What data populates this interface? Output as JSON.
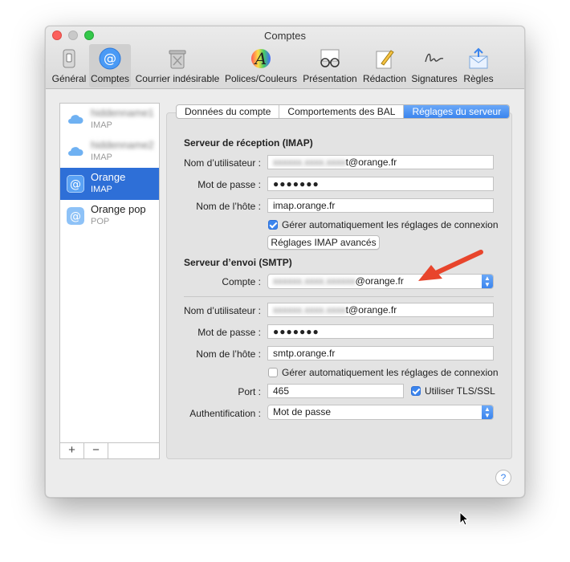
{
  "window": {
    "title": "Comptes"
  },
  "toolbar": {
    "items": [
      {
        "label": "Général",
        "icon": "switch-icon"
      },
      {
        "label": "Comptes",
        "icon": "at-icon",
        "selected": true
      },
      {
        "label": "Courrier indésirable",
        "icon": "trash-icon"
      },
      {
        "label": "Polices/Couleurs",
        "icon": "font-icon"
      },
      {
        "label": "Présentation",
        "icon": "glasses-icon"
      },
      {
        "label": "Rédaction",
        "icon": "pencil-icon"
      },
      {
        "label": "Signatures",
        "icon": "signature-icon"
      },
      {
        "label": "Règles",
        "icon": "rules-icon"
      }
    ]
  },
  "sidebar": {
    "accounts": [
      {
        "name": "hiddenname1",
        "type": "IMAP",
        "icon": "cloud-icon"
      },
      {
        "name": "hiddenname2",
        "type": "IMAP",
        "icon": "cloud-icon"
      },
      {
        "name": "Orange",
        "type": "IMAP",
        "icon": "at-icon",
        "selected": true
      },
      {
        "name": "Orange pop",
        "type": "POP",
        "icon": "at-icon"
      }
    ],
    "add_label": "+",
    "remove_label": "−"
  },
  "tabs": [
    {
      "label": "Données du compte"
    },
    {
      "label": "Comportements des BAL"
    },
    {
      "label": "Réglages du serveur",
      "active": true
    }
  ],
  "incoming": {
    "title": "Serveur de réception (IMAP)",
    "username_label": "Nom d’utilisateur :",
    "username_hidden": "xxxxxx.xxxx.xxxx",
    "username_suffix": "t@orange.fr",
    "password_label": "Mot de passe :",
    "password_value": "●●●●●●●",
    "host_label": "Nom de l’hôte :",
    "host_value": "imap.orange.fr",
    "auto_label": "Gérer automatiquement les réglages de connexion",
    "auto_checked": true,
    "advanced_button": "Réglages IMAP avancés"
  },
  "outgoing": {
    "title": "Serveur d’envoi (SMTP)",
    "account_label": "Compte :",
    "account_hidden": "xxxxxx.xxxx.xxxxxx",
    "account_suffix": "@orange.fr",
    "username_label": "Nom d’utilisateur :",
    "username_hidden": "xxxxxx.xxxx.xxxx",
    "username_suffix": "t@orange.fr",
    "password_label": "Mot de passe :",
    "password_value": "●●●●●●●",
    "host_label": "Nom de l’hôte :",
    "host_value": "smtp.orange.fr",
    "auto_label": "Gérer automatiquement les réglages de connexion",
    "auto_checked": false,
    "port_label": "Port :",
    "port_value": "465",
    "tls_label": "Utiliser TLS/SSL",
    "tls_checked": true,
    "auth_label": "Authentification :",
    "auth_value": "Mot de passe"
  },
  "help_label": "?",
  "colors": {
    "accent": "#3b85ee",
    "selection": "#2e6fd7",
    "arrow": "#e8452c"
  }
}
